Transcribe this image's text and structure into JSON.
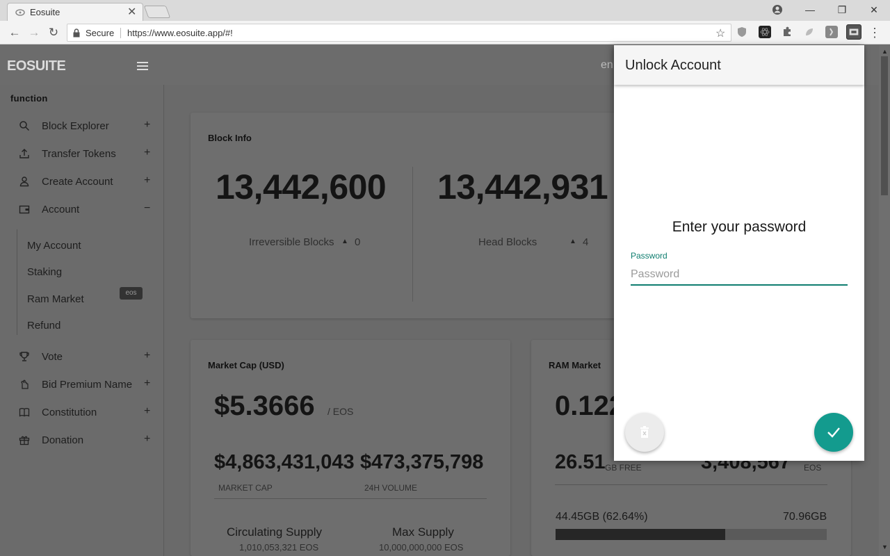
{
  "browser": {
    "tab_title": "Eosuite",
    "tab_close": "✕",
    "secure_label": "Secure",
    "url": "https://www.eosuite.app/#!",
    "window_controls": {
      "minimize": "—",
      "restore": "❐",
      "close": "✕"
    },
    "nav": {
      "back": "←",
      "forward": "→",
      "reload": "↻"
    },
    "star": "☆",
    "menu": "⋮"
  },
  "app": {
    "brand": "EOSUITE",
    "language_text": "en"
  },
  "sidebar": {
    "heading": "function",
    "items": [
      {
        "label": "Block Explorer",
        "toggle": "+",
        "icon": "search-icon"
      },
      {
        "label": "Transfer Tokens",
        "toggle": "+",
        "icon": "upload-icon"
      },
      {
        "label": "Create Account",
        "toggle": "+",
        "icon": "user-icon"
      },
      {
        "label": "Account",
        "toggle": "−",
        "icon": "wallet-icon"
      },
      {
        "label": "Vote",
        "toggle": "+",
        "icon": "trophy-icon"
      },
      {
        "label": "Bid Premium Name",
        "toggle": "+",
        "icon": "hand-icon"
      },
      {
        "label": "Constitution",
        "toggle": "+",
        "icon": "book-icon"
      },
      {
        "label": "Donation",
        "toggle": "+",
        "icon": "gift-icon"
      }
    ],
    "account_sub": [
      "My Account",
      "Staking",
      "Ram Market",
      "Refund"
    ],
    "ram_badge": "eos"
  },
  "block_info": {
    "title": "Block Info",
    "irreversible": {
      "value": "13,442,600",
      "label": "Irreversible Blocks",
      "delta": "0"
    },
    "head": {
      "value": "13,442,931",
      "label": "Head Blocks",
      "delta": "4"
    }
  },
  "market_cap": {
    "title": "Market Cap (USD)",
    "price": "$5.3666",
    "price_unit": "/ EOS",
    "cap": "$4,863,431,043",
    "cap_label": "MARKET CAP",
    "volume": "$473,375,798",
    "volume_label": "24H VOLUME",
    "circulating_label": "Circulating Supply",
    "circulating_value": "1,010,053,321 EOS",
    "max_label": "Max Supply",
    "max_value": "10,000,000,000 EOS"
  },
  "ram_market": {
    "title": "RAM Market",
    "price": "0.122",
    "free": "26.51",
    "free_unit": "GB FREE",
    "reserve": "3,408,567",
    "reserve_unit": "EOS",
    "used": "44.45GB (62.64%)",
    "total": "70.96GB",
    "used_fraction": 0.6264
  },
  "dialog": {
    "title": "Unlock Account",
    "heading": "Enter your password",
    "password_label": "Password",
    "password_placeholder": "Password",
    "password_value": ""
  },
  "colors": {
    "accent": "#139b8e",
    "accent_text": "#0e7d6f",
    "overlay": "#6a6a6a"
  }
}
